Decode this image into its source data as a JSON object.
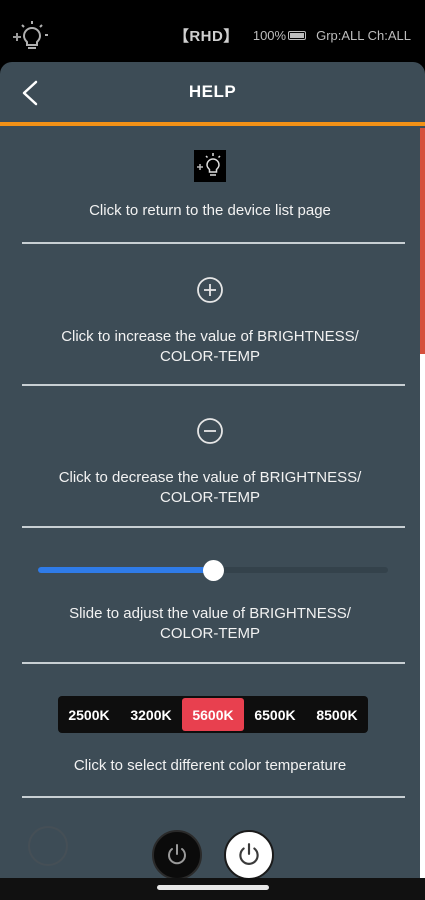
{
  "status_bar": {
    "device_label": "【RHD】",
    "battery": "100%",
    "group_channel": "Grp:ALL Ch:ALL"
  },
  "header": {
    "title": "HELP"
  },
  "help_items": [
    {
      "icon": "bulb-icon",
      "text": "Click to return to the device list page"
    },
    {
      "icon": "plus-circle-icon",
      "text": "Click to increase the value of BRIGHTNESS/ COLOR-TEMP"
    },
    {
      "icon": "minus-circle-icon",
      "text": "Click to decrease the value of BRIGHTNESS/ COLOR-TEMP"
    },
    {
      "icon": "slider-icon",
      "text": "Slide to adjust the value of BRIGHTNESS/ COLOR-TEMP"
    },
    {
      "icon": "color-temp-selector",
      "text": "Click to select different color temperature"
    }
  ],
  "slider_demo": {
    "level": 0.5
  },
  "color_temps": {
    "options": [
      "2500K",
      "3200K",
      "5600K",
      "6500K",
      "8500K"
    ],
    "selected": "5600K"
  },
  "colors": {
    "accent": "#f29116",
    "panel": "#3d4c56",
    "slider_fill": "#2f7be8",
    "selected_temp": "#e8404f"
  }
}
